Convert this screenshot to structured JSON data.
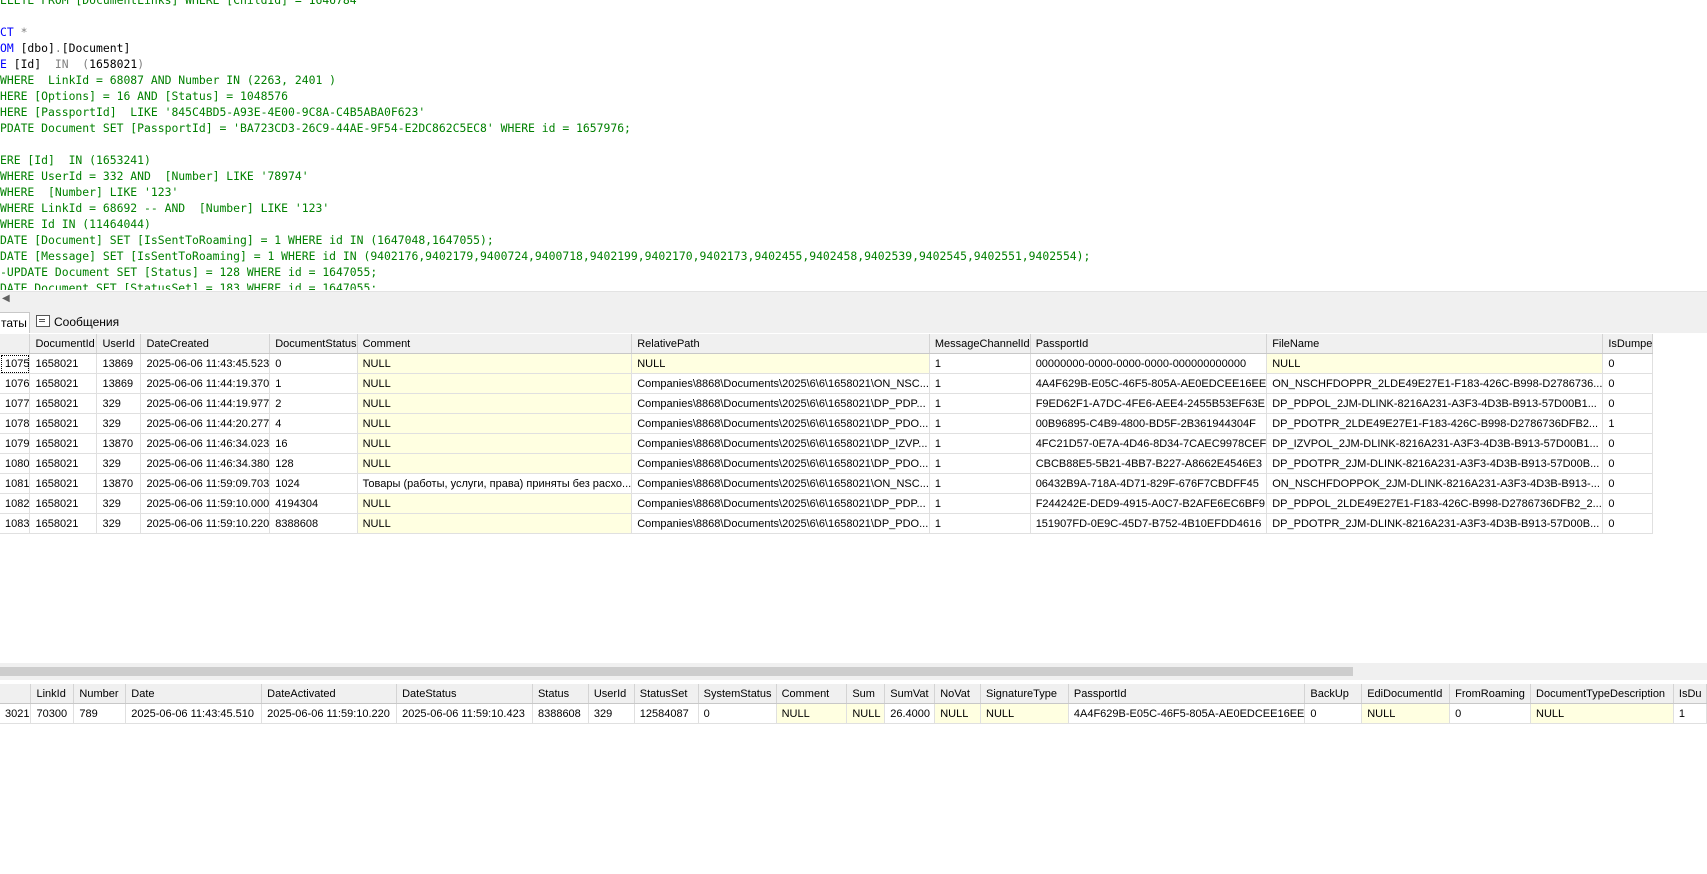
{
  "editor": {
    "lines": [
      [
        {
          "t": "ELETE FROM [DocumentLinks] WHERE [ChildId] = 1646784",
          "c": "cm"
        }
      ],
      [
        {
          "t": "",
          "c": ""
        }
      ],
      [
        {
          "t": "CT ",
          "c": "kw"
        },
        {
          "t": "*",
          "c": "gr"
        }
      ],
      [
        {
          "t": "OM ",
          "c": "kw"
        },
        {
          "t": "[dbo]",
          "c": ""
        },
        {
          "t": ".",
          "c": "gr"
        },
        {
          "t": "[Document]",
          "c": ""
        }
      ],
      [
        {
          "t": "E ",
          "c": "kw"
        },
        {
          "t": "[Id]  ",
          "c": ""
        },
        {
          "t": "IN  (",
          "c": "gr"
        },
        {
          "t": "1658021",
          "c": ""
        },
        {
          "t": ")",
          "c": "gr"
        }
      ],
      [
        {
          "t": "WHERE  LinkId = 68087 AND Number IN (2263, 2401 )",
          "c": "cm"
        }
      ],
      [
        {
          "t": "HERE [Options] = 16 AND [Status] = 1048576",
          "c": "cm"
        }
      ],
      [
        {
          "t": "HERE [PassportId]  LIKE '845C4BD5-A93E-4E00-9C8A-C4B5ABA0F623'",
          "c": "cm"
        }
      ],
      [
        {
          "t": "PDATE Document SET [PassportId] = 'BA723CD3-26C9-44AE-9F54-E2DC862C5EC8' WHERE id = 1657976;",
          "c": "cm"
        }
      ],
      [
        {
          "t": "",
          "c": ""
        }
      ],
      [
        {
          "t": "ERE [Id]  IN (1653241)",
          "c": "cm"
        }
      ],
      [
        {
          "t": "WHERE UserId = 332 AND  [Number] LIKE '78974'",
          "c": "cm"
        }
      ],
      [
        {
          "t": "WHERE  [Number] LIKE '123'",
          "c": "cm"
        }
      ],
      [
        {
          "t": "WHERE LinkId = 68692 -- AND  [Number] LIKE '123'",
          "c": "cm"
        }
      ],
      [
        {
          "t": "WHERE Id IN (11464044)",
          "c": "cm"
        }
      ],
      [
        {
          "t": "DATE [Document] SET [IsSentToRoaming] = 1 WHERE id IN (1647048,1647055);",
          "c": "cm"
        }
      ],
      [
        {
          "t": "DATE [Message] SET [IsSentToRoaming] = 1 WHERE id IN (9402176,9402179,9400724,9400718,9402199,9402170,9402173,9402455,9402458,9402539,9402545,9402551,9402554);",
          "c": "cm"
        }
      ],
      [
        {
          "t": "-UPDATE Document SET [Status] = 128 WHERE id = 1647055;",
          "c": "cm"
        }
      ],
      [
        {
          "t": "DATE Document SET [StatusSet] = 183 WHERE id = 1647055;",
          "c": "cm"
        }
      ]
    ]
  },
  "tabs": {
    "results_label": "таты",
    "messages_label": "Сообщения"
  },
  "grid1": {
    "columns": [
      "",
      "DocumentId",
      "UserId",
      "DateCreated",
      "DocumentStatus",
      "Comment",
      "RelativePath",
      "MessageChannelId",
      "PassportId",
      "FileName",
      "IsDumpe"
    ],
    "rows": [
      [
        "1075",
        "1658021",
        "13869",
        "2025-06-06 11:43:45.523",
        "0",
        "NULL",
        "NULL",
        "1",
        "00000000-0000-0000-0000-000000000000",
        "NULL",
        "0"
      ],
      [
        "1076",
        "1658021",
        "13869",
        "2025-06-06 11:44:19.370",
        "1",
        "NULL",
        "Companies\\8868\\Documents\\2025\\6\\6\\1658021\\ON_NSC...",
        "1",
        "4A4F629B-E05C-46F5-805A-AE0EDCEE16EE",
        "ON_NSCHFDOPPR_2LDE49E27E1-F183-426C-B998-D2786736...",
        "0"
      ],
      [
        "1077",
        "1658021",
        "329",
        "2025-06-06 11:44:19.977",
        "2",
        "NULL",
        "Companies\\8868\\Documents\\2025\\6\\6\\1658021\\DP_PDP...",
        "1",
        "F9ED62F1-A7DC-4FE6-AEE4-2455B53EF63E",
        "DP_PDPOL_2JM-DLINK-8216A231-A3F3-4D3B-B913-57D00B1...",
        "0"
      ],
      [
        "1078",
        "1658021",
        "329",
        "2025-06-06 11:44:20.277",
        "4",
        "NULL",
        "Companies\\8868\\Documents\\2025\\6\\6\\1658021\\DP_PDO...",
        "1",
        "00B96895-C4B9-4800-BD5F-2B361944304F",
        "DP_PDOTPR_2LDE49E27E1-F183-426C-B998-D2786736DFB2...",
        "1"
      ],
      [
        "1079",
        "1658021",
        "13870",
        "2025-06-06 11:46:34.023",
        "16",
        "NULL",
        "Companies\\8868\\Documents\\2025\\6\\6\\1658021\\DP_IZVP...",
        "1",
        "4FC21D57-0E7A-4D46-8D34-7CAEC9978CEF",
        "DP_IZVPOL_2JM-DLINK-8216A231-A3F3-4D3B-B913-57D00B1...",
        "0"
      ],
      [
        "1080",
        "1658021",
        "329",
        "2025-06-06 11:46:34.380",
        "128",
        "NULL",
        "Companies\\8868\\Documents\\2025\\6\\6\\1658021\\DP_PDO...",
        "1",
        "CBCB88E5-5B21-4BB7-B227-A8662E4546E3",
        "DP_PDOTPR_2JM-DLINK-8216A231-A3F3-4D3B-B913-57D00B...",
        "0"
      ],
      [
        "1081",
        "1658021",
        "13870",
        "2025-06-06 11:59:09.703",
        "1024",
        "Товары (работы, услуги, права) приняты без расхо...",
        "Companies\\8868\\Documents\\2025\\6\\6\\1658021\\ON_NSC...",
        "1",
        "06432B9A-718A-4D71-829F-676F7CBDFF45",
        "ON_NSCHFDOPPOK_2JM-DLINK-8216A231-A3F3-4D3B-B913-...",
        "0"
      ],
      [
        "1082",
        "1658021",
        "329",
        "2025-06-06 11:59:10.000",
        "4194304",
        "NULL",
        "Companies\\8868\\Documents\\2025\\6\\6\\1658021\\DP_PDP...",
        "1",
        "F244242E-DED9-4915-A0C7-B2AFE6EC6BF9",
        "DP_PDPOL_2LDE49E27E1-F183-426C-B998-D2786736DFB2_2...",
        "0"
      ],
      [
        "1083",
        "1658021",
        "329",
        "2025-06-06 11:59:10.220",
        "8388608",
        "NULL",
        "Companies\\8868\\Documents\\2025\\6\\6\\1658021\\DP_PDO...",
        "1",
        "151907FD-0E9C-45D7-B752-4B10EFDD4616",
        "DP_PDOTPR_2JM-DLINK-8216A231-A3F3-4D3B-B913-57D00B...",
        "0"
      ]
    ]
  },
  "grid2": {
    "columns": [
      "",
      "LinkId",
      "Number",
      "Date",
      "DateActivated",
      "DateStatus",
      "Status",
      "UserId",
      "StatusSet",
      "SystemStatus",
      "Comment",
      "Sum",
      "SumVat",
      "NoVat",
      "SignatureType",
      "PassportId",
      "BackUp",
      "EdiDocumentId",
      "FromRoaming",
      "DocumentTypeDescription",
      "IsDu"
    ],
    "rows": [
      [
        "3021",
        "70300",
        "789",
        "2025-06-06 11:43:45.510",
        "2025-06-06 11:59:10.220",
        "2025-06-06 11:59:10.423",
        "8388608",
        "329",
        "12584087",
        "0",
        "NULL",
        "NULL",
        "26.4000",
        "NULL",
        "NULL",
        "4A4F629B-E05C-46F5-805A-AE0EDCEE16EE",
        "0",
        "NULL",
        "0",
        "NULL",
        "1"
      ]
    ]
  }
}
